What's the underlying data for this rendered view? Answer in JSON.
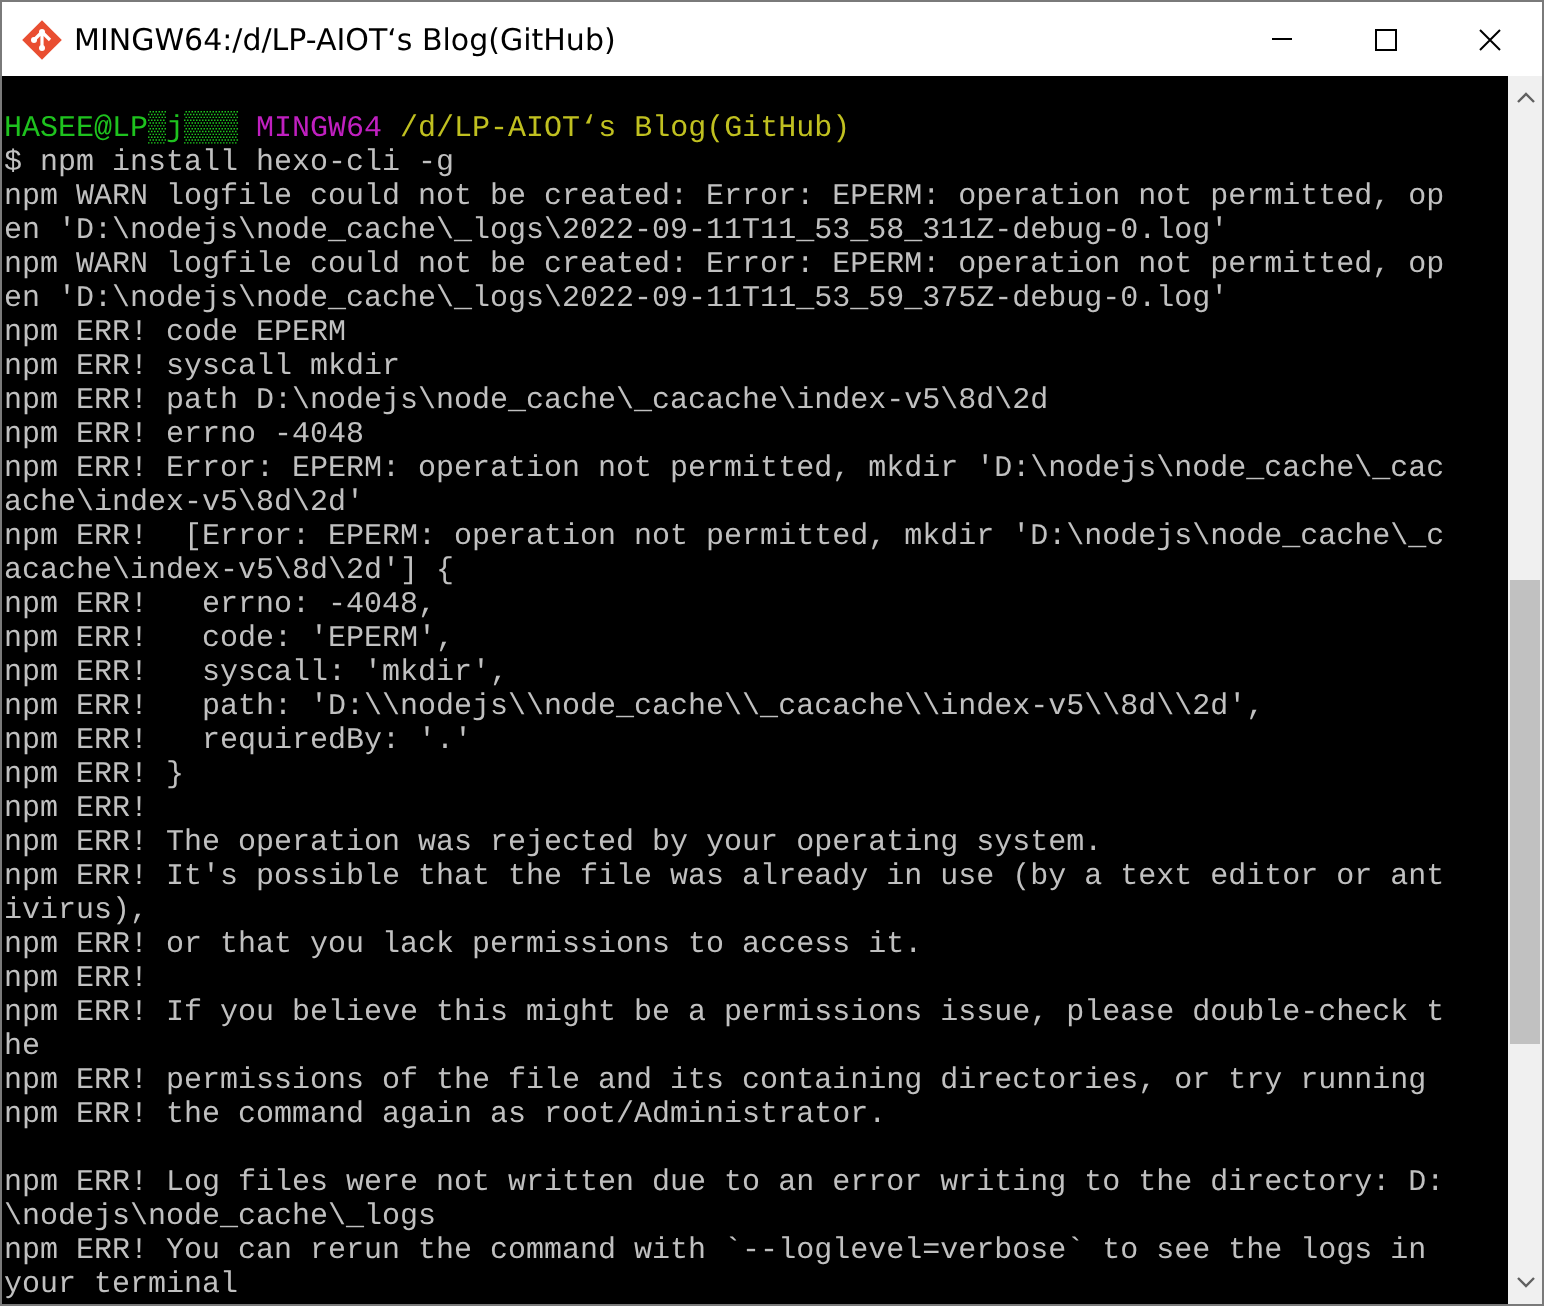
{
  "window": {
    "title": "MINGW64:/d/LP-AIOT‘s Blog(GitHub)"
  },
  "terminal": {
    "prompt": [
      {
        "text": "HASEE@LP▒j▒▒▒",
        "color": "#1ec21e"
      },
      {
        "text": "MINGW64",
        "color": "#c020c0"
      },
      {
        "text": "/d/LP-AIOT‘s Blog(GitHub)",
        "color": "#c0c020"
      }
    ],
    "lines": [
      {
        "kind": "text",
        "text": "$ npm install hexo-cli -g"
      },
      {
        "kind": "text",
        "text": "npm WARN logfile could not be created: Error: EPERM: operation not permitted, op"
      },
      {
        "kind": "text",
        "text": "en 'D:\\nodejs\\node_cache\\_logs\\2022-09-11T11_53_58_311Z-debug-0.log'"
      },
      {
        "kind": "text",
        "text": "npm WARN logfile could not be created: Error: EPERM: operation not permitted, op"
      },
      {
        "kind": "text",
        "text": "en 'D:\\nodejs\\node_cache\\_logs\\2022-09-11T11_53_59_375Z-debug-0.log'"
      },
      {
        "kind": "text",
        "text": "npm ERR! code EPERM"
      },
      {
        "kind": "text",
        "text": "npm ERR! syscall mkdir"
      },
      {
        "kind": "text",
        "text": "npm ERR! path D:\\nodejs\\node_cache\\_cacache\\index-v5\\8d\\2d"
      },
      {
        "kind": "text",
        "text": "npm ERR! errno -4048"
      },
      {
        "kind": "text",
        "text": "npm ERR! Error: EPERM: operation not permitted, mkdir 'D:\\nodejs\\node_cache\\_cac"
      },
      {
        "kind": "text",
        "text": "ache\\index-v5\\8d\\2d'"
      },
      {
        "kind": "text",
        "text": "npm ERR!  [Error: EPERM: operation not permitted, mkdir 'D:\\nodejs\\node_cache\\_c"
      },
      {
        "kind": "text",
        "text": "acache\\index-v5\\8d\\2d'] {"
      },
      {
        "kind": "text",
        "text": "npm ERR!   errno: -4048,"
      },
      {
        "kind": "text",
        "text": "npm ERR!   code: 'EPERM',"
      },
      {
        "kind": "text",
        "text": "npm ERR!   syscall: 'mkdir',"
      },
      {
        "kind": "text",
        "text": "npm ERR!   path: 'D:\\\\nodejs\\\\node_cache\\\\_cacache\\\\index-v5\\\\8d\\\\2d',"
      },
      {
        "kind": "text",
        "text": "npm ERR!   requiredBy: '.'"
      },
      {
        "kind": "text",
        "text": "npm ERR! }"
      },
      {
        "kind": "text",
        "text": "npm ERR!"
      },
      {
        "kind": "text",
        "text": "npm ERR! The operation was rejected by your operating system."
      },
      {
        "kind": "text",
        "text": "npm ERR! It's possible that the file was already in use (by a text editor or ant"
      },
      {
        "kind": "text",
        "text": "ivirus),"
      },
      {
        "kind": "text",
        "text": "npm ERR! or that you lack permissions to access it."
      },
      {
        "kind": "text",
        "text": "npm ERR!"
      },
      {
        "kind": "text",
        "text": "npm ERR! If you believe this might be a permissions issue, please double-check t"
      },
      {
        "kind": "text",
        "text": "he"
      },
      {
        "kind": "text",
        "text": "npm ERR! permissions of the file and its containing directories, or try running"
      },
      {
        "kind": "text",
        "text": "npm ERR! the command again as root/Administrator."
      },
      {
        "kind": "blank"
      },
      {
        "kind": "text",
        "text": "npm ERR! Log files were not written due to an error writing to the directory: D:"
      },
      {
        "kind": "text",
        "text": "\\nodejs\\node_cache\\_logs"
      },
      {
        "kind": "text",
        "text": "npm ERR! You can rerun the command with `--loglevel=verbose` to see the logs in"
      },
      {
        "kind": "text",
        "text": "your terminal"
      }
    ]
  }
}
